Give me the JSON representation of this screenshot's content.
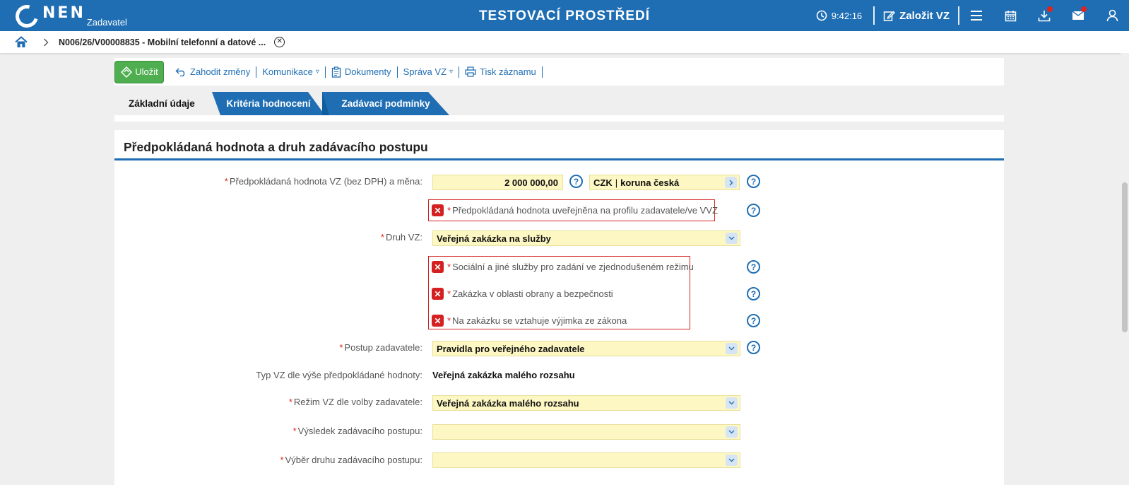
{
  "header": {
    "logo_text": "NEN",
    "logo_sub": "Zadavatel",
    "environment_title": "TESTOVACÍ PROSTŘEDÍ",
    "time": "9:42:16",
    "new_vz_label": "Založit VZ",
    "accent_color": "#1f6eb3"
  },
  "breadcrumb": {
    "title": "N006/26/V00008835 - Mobilní telefonní a datové ..."
  },
  "toolbar": {
    "save_label": "Uložit",
    "discard_label": "Zahodit změny",
    "communication_label": "Komunikace",
    "documents_label": "Dokumenty",
    "management_label": "Správa VZ",
    "print_label": "Tisk záznamu"
  },
  "tabs": [
    {
      "label": "Základní údaje",
      "active": true
    },
    {
      "label": "Kritéria hodnocení",
      "active": false
    },
    {
      "label": "Zadávací podmínky",
      "active": false
    }
  ],
  "section": {
    "title": "Předpokládaná hodnota a druh zadávacího postupu"
  },
  "form": {
    "estimated_value": {
      "label": "Předpokládaná hodnota VZ (bez DPH) a měna:",
      "value": "2 000 000,00",
      "currency_code": "CZK",
      "currency_name": "koruna česká"
    },
    "published_value_check": {
      "label": "Předpokládaná hodnota uveřejněna na profilu zadavatele/ve VVZ",
      "checked": false
    },
    "contract_type": {
      "label": "Druh VZ:",
      "value": "Veřejná zakázka na služby"
    },
    "checks": [
      {
        "label": "Sociální a jiné služby pro zadání ve zjednodušeném režimu",
        "checked": false
      },
      {
        "label": "Zakázka v oblasti obrany a bezpečnosti",
        "checked": false
      },
      {
        "label": "Na zakázku se vztahuje výjimka ze zákona",
        "checked": false
      }
    ],
    "procedure": {
      "label": "Postup zadavatele:",
      "value": "Pravidla pro veřejného zadavatele"
    },
    "type_by_value": {
      "label": "Typ VZ dle výše předpokládané hodnoty:",
      "value": "Veřejná zakázka malého rozsahu"
    },
    "regime": {
      "label": "Režim VZ dle volby zadavatele:",
      "value": "Veřejná zakázka malého rozsahu"
    },
    "result": {
      "label": "Výsledek zadávacího postupu:",
      "value": ""
    },
    "procedure_kind": {
      "label": "Výběr druhu zadávacího postupu:",
      "value": ""
    }
  }
}
